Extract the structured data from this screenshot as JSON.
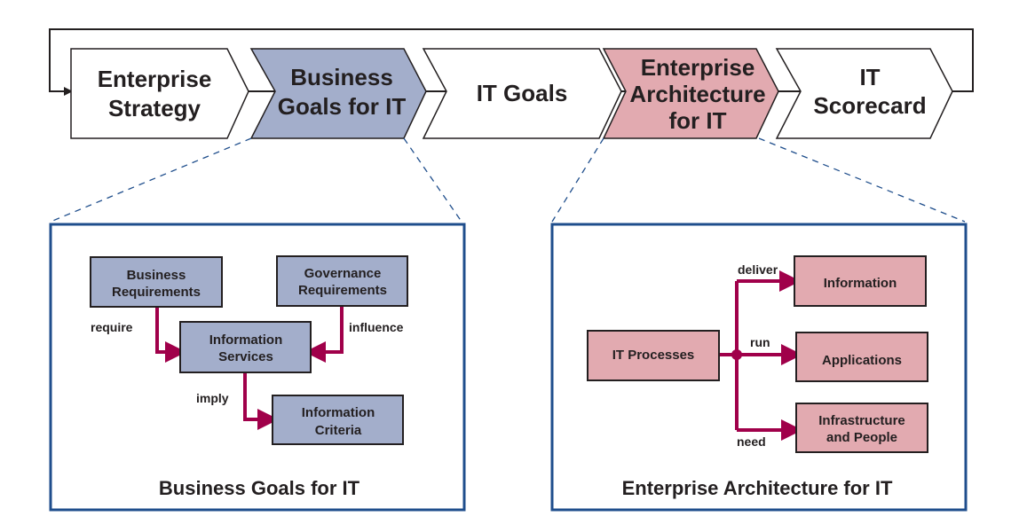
{
  "colors": {
    "blue_fill": "#a3aecb",
    "pink_fill": "#e2aab0",
    "connector": "#a0004a",
    "frame": "#1f4e8c"
  },
  "chevrons": [
    {
      "lines": [
        "Enterprise",
        "Strategy"
      ]
    },
    {
      "lines": [
        "Business",
        "Goals for IT"
      ]
    },
    {
      "lines": [
        "IT Goals"
      ]
    },
    {
      "lines": [
        "Enterprise",
        "Architecture",
        "for IT"
      ]
    },
    {
      "lines": [
        "IT",
        "Scorecard"
      ]
    }
  ],
  "left_panel": {
    "title": "Business Goals for IT",
    "boxes": {
      "business_requirements": [
        "Business",
        "Requirements"
      ],
      "governance_requirements": [
        "Governance",
        "Requirements"
      ],
      "information_services": [
        "Information",
        "Services"
      ],
      "information_criteria": [
        "Information",
        "Criteria"
      ]
    },
    "labels": {
      "require": "require",
      "influence": "influence",
      "imply": "imply"
    }
  },
  "right_panel": {
    "title": "Enterprise Architecture for IT",
    "boxes": {
      "it_processes": [
        "IT Processes"
      ],
      "information": [
        "Information"
      ],
      "applications": [
        "Applications"
      ],
      "infrastructure": [
        "Infrastructure",
        "and People"
      ]
    },
    "labels": {
      "deliver": "deliver",
      "run": "run",
      "need": "need"
    }
  }
}
